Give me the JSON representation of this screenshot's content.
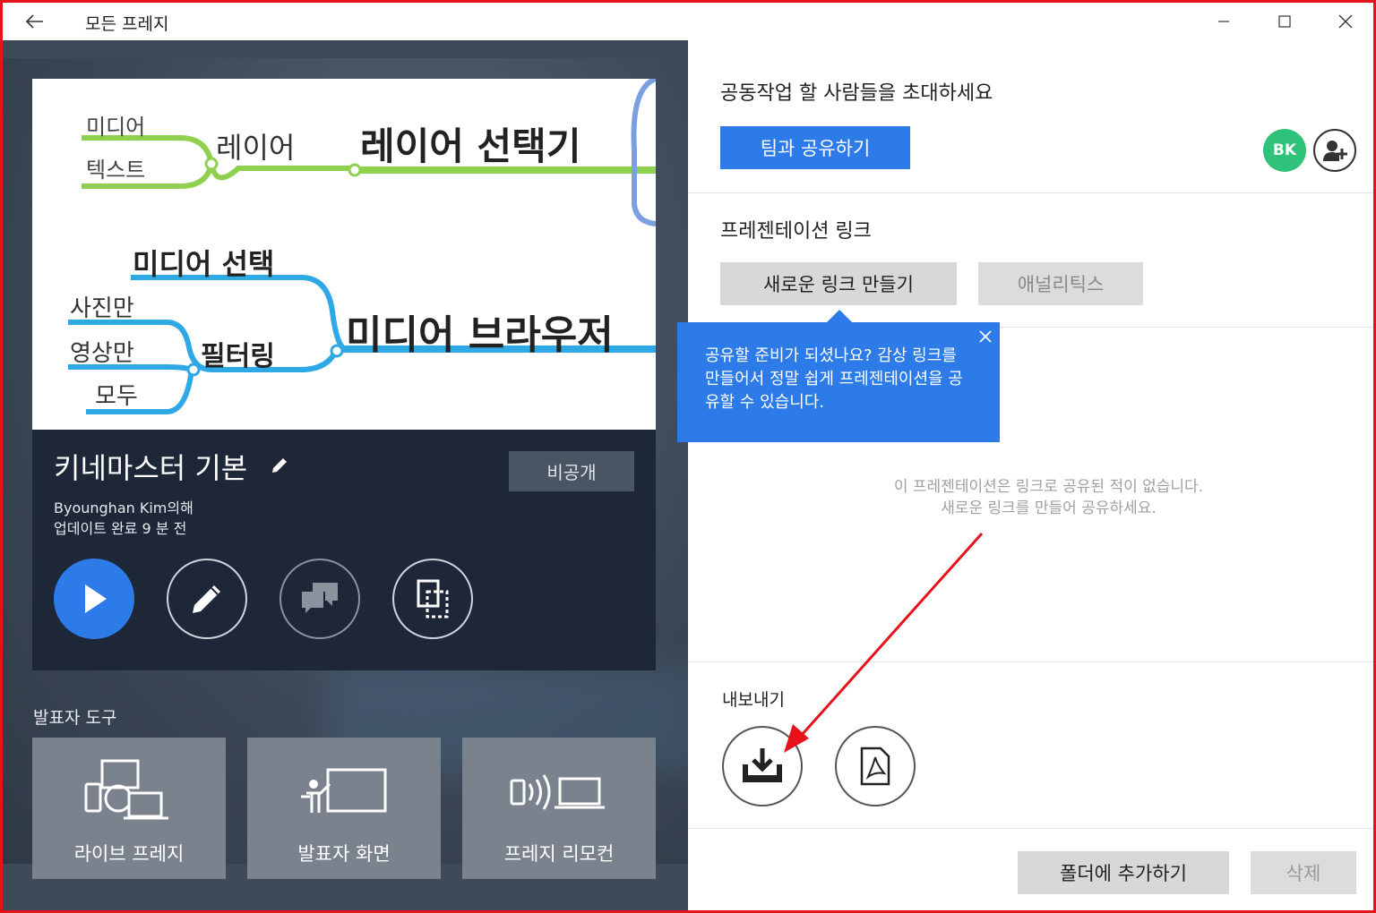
{
  "window": {
    "title": "모든 프레지",
    "back_icon": "arrow-left-icon",
    "controls": [
      "minimize-icon",
      "maximize-icon",
      "close-icon"
    ]
  },
  "thumbnail": {
    "nodes": {
      "media": "미디어",
      "text": "텍스트",
      "layer": "레이어",
      "layer_selector": "레이어 선택기",
      "media_select": "미디어 선택",
      "photo_only": "사진만",
      "video_only": "영상만",
      "all": "모두",
      "filtering": "필터링",
      "media_browser": "미디어 브라우저"
    },
    "colors": {
      "green": "#8fd14f",
      "blue": "#2fa8e6",
      "frame": "#7b9fe0"
    }
  },
  "presentation": {
    "title": "키네마스터 기본",
    "owner": "Byounghan Kim의해",
    "updated": "업데이트 완료 9 분 전",
    "privacy_label": "비공개",
    "actions": [
      "play-icon",
      "pencil-icon",
      "comments-icon",
      "copy-icon"
    ]
  },
  "presenter_tools": {
    "label": "발표자 도구",
    "items": [
      {
        "label": "라이브 프레지",
        "icon": "live-prezi-icon"
      },
      {
        "label": "발표자 화면",
        "icon": "presenter-view-icon"
      },
      {
        "label": "프레지 리모컨",
        "icon": "remote-icon"
      }
    ]
  },
  "share": {
    "invite_title": "공동작업 할 사람들을 초대하세요",
    "team_share_label": "팀과 공유하기",
    "avatar_initials": "BK",
    "avatar_color": "#2fc27b",
    "add_user_icon": "add-user-icon"
  },
  "links": {
    "title": "프레젠테이션 링크",
    "new_link_label": "새로운 링크 만들기",
    "analytics_label": "애널리틱스",
    "tooltip": "공유할 준비가 되셨나요? 감상 링크를 만들어서 정말 쉽게 프레젠테이션을 공유할 수 있습니다.",
    "empty_line1": "이 프레젠테이션은 링크로 공유된 적이 없습니다.",
    "empty_line2": "새로운 링크를 만들어 공유하세요."
  },
  "export": {
    "title": "내보내기",
    "items": [
      "download-icon",
      "pdf-icon"
    ]
  },
  "footer": {
    "add_to_folder_label": "폴더에 추가하기",
    "delete_label": "삭제"
  },
  "accent_color": "#2d7be8"
}
